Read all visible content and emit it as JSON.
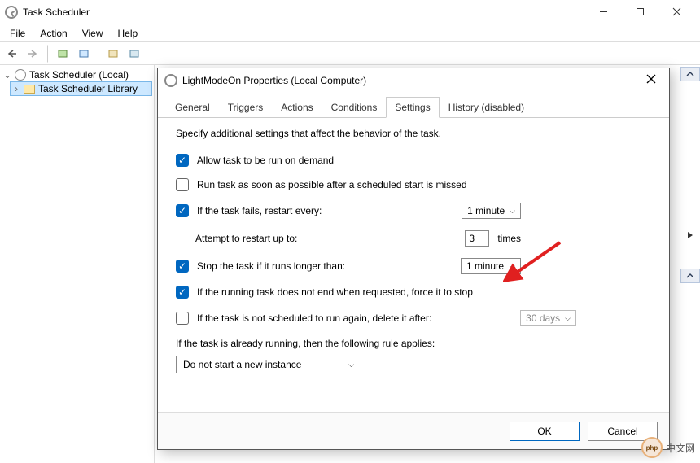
{
  "window": {
    "title": "Task Scheduler"
  },
  "menu": {
    "file": "File",
    "action": "Action",
    "view": "View",
    "help": "Help"
  },
  "tree": {
    "root": "Task Scheduler (Local)",
    "lib": "Task Scheduler Library"
  },
  "dialog": {
    "title": "LightModeOn Properties (Local Computer)",
    "tabs": {
      "general": "General",
      "triggers": "Triggers",
      "actions": "Actions",
      "conditions": "Conditions",
      "settings": "Settings",
      "history": "History (disabled)"
    },
    "intro": "Specify additional settings that affect the behavior of the task.",
    "opts": {
      "allow_demand": "Allow task to be run on demand",
      "run_asap": "Run task as soon as possible after a scheduled start is missed",
      "restart_label": "If the task fails, restart every:",
      "restart_interval": "1 minute",
      "attempt_label": "Attempt to restart up to:",
      "attempt_value": "3",
      "attempt_suffix": "times",
      "stop_longer": "Stop the task if it runs longer than:",
      "stop_longer_value": "1 minute",
      "force_stop": "If the running task does not end when requested, force it to stop",
      "delete_after": "If the task is not scheduled to run again, delete it after:",
      "delete_after_value": "30 days",
      "rule_label": "If the task is already running, then the following rule applies:",
      "rule_value": "Do not start a new instance"
    },
    "buttons": {
      "ok": "OK",
      "cancel": "Cancel"
    }
  },
  "watermark": "中文网"
}
